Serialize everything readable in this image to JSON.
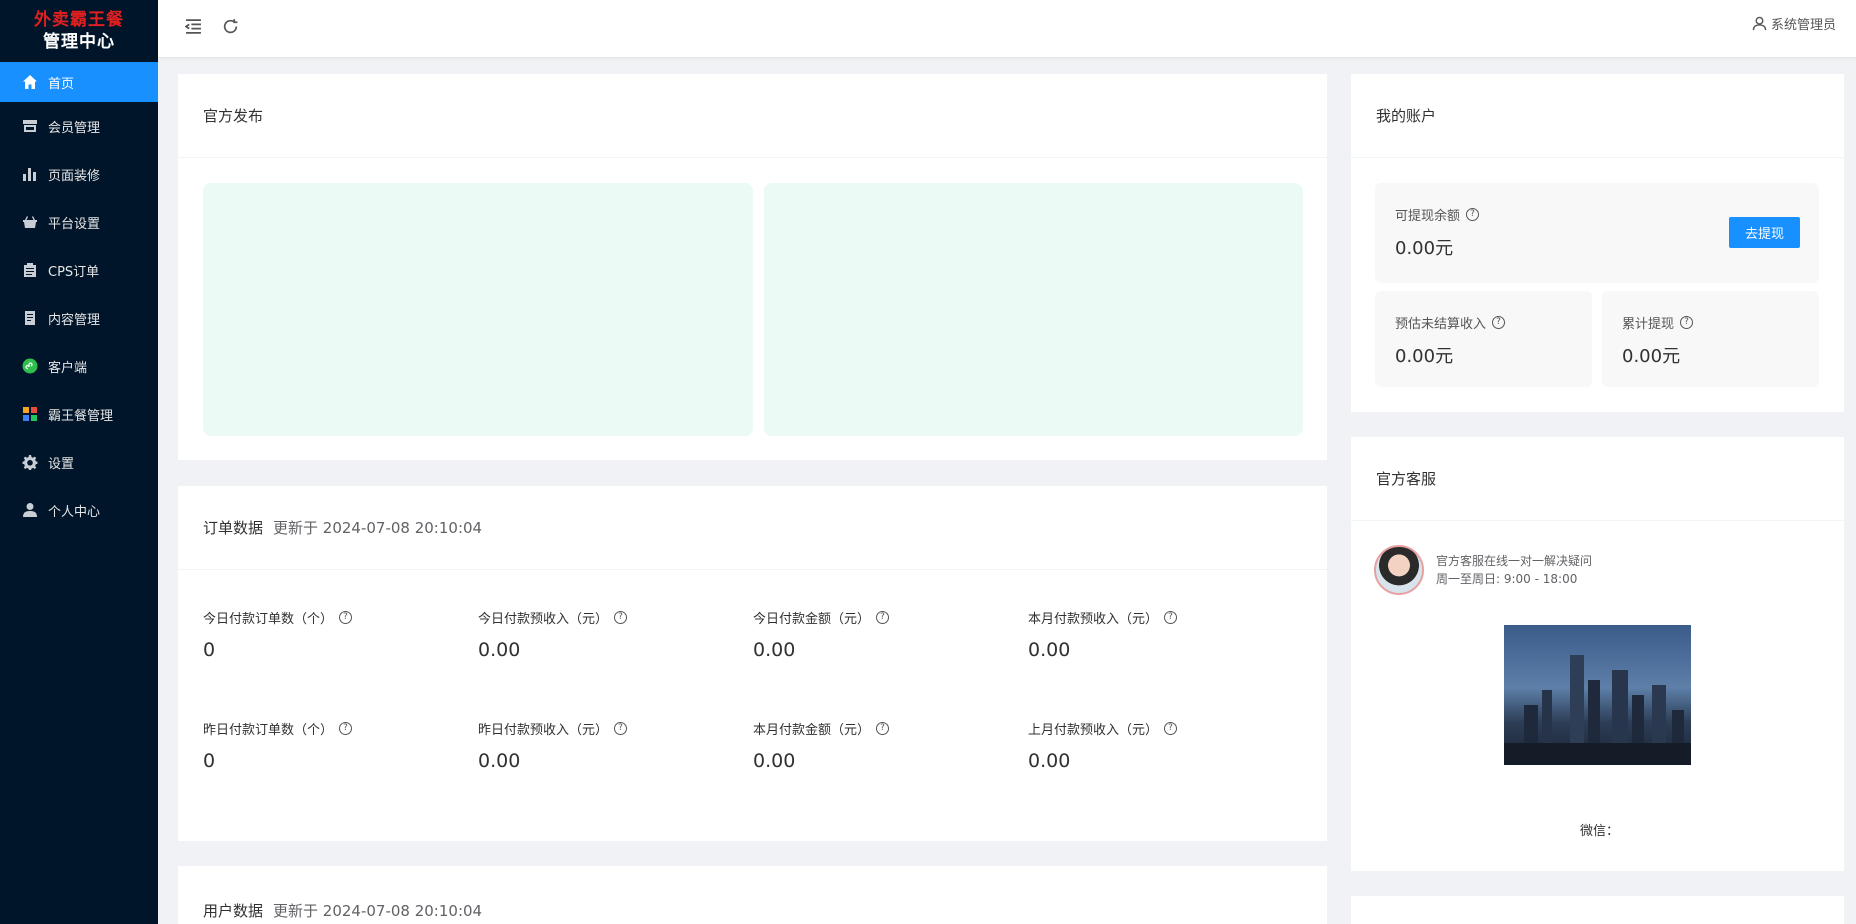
{
  "brand": {
    "line1": "外卖霸王餐",
    "line2": "管理中心"
  },
  "menu": [
    {
      "label": "首页",
      "icon": "home-icon",
      "active": true
    },
    {
      "label": "会员管理",
      "icon": "store-icon"
    },
    {
      "label": "页面装修",
      "icon": "bar-chart-icon"
    },
    {
      "label": "平台设置",
      "icon": "basket-icon"
    },
    {
      "label": "CPS订单",
      "icon": "clipboard-icon"
    },
    {
      "label": "内容管理",
      "icon": "document-icon"
    },
    {
      "label": "客户端",
      "icon": "mini-program-icon"
    },
    {
      "label": "霸王餐管理",
      "icon": "apps-icon"
    },
    {
      "label": "设置",
      "icon": "gear-icon"
    },
    {
      "label": "个人中心",
      "icon": "user-icon"
    }
  ],
  "header": {
    "user": "系统管理员"
  },
  "official": {
    "title": "官方发布"
  },
  "orders": {
    "title": "订单数据",
    "updated": "更新于 2024-07-08 20:10:04",
    "stats": [
      {
        "label": "今日付款订单数（个）",
        "value": "0"
      },
      {
        "label": "今日付款预收入（元）",
        "value": "0.00"
      },
      {
        "label": "今日付款金额（元）",
        "value": "0.00"
      },
      {
        "label": "本月付款预收入（元）",
        "value": "0.00"
      },
      {
        "label": "昨日付款订单数（个）",
        "value": "0"
      },
      {
        "label": "昨日付款预收入（元）",
        "value": "0.00"
      },
      {
        "label": "本月付款金额（元）",
        "value": "0.00"
      },
      {
        "label": "上月付款预收入（元）",
        "value": "0.00"
      }
    ]
  },
  "users": {
    "title": "用户数据",
    "updated": "更新于 2024-07-08 20:10:04"
  },
  "account": {
    "title": "我的账户",
    "withdrawable_label": "可提现余额",
    "withdrawable_value": "0.00元",
    "withdraw_button": "去提现",
    "unsettled_label": "预估未结算收入",
    "unsettled_value": "0.00元",
    "total_label": "累计提现",
    "total_value": "0.00元"
  },
  "service": {
    "title": "官方客服",
    "line1": "官方客服在线一对一解决疑问",
    "line2": "周一至周日: 9:00 - 18:00",
    "wechat": "微信："
  },
  "colors": {
    "sidebar": "#001529",
    "primary": "#1890ff",
    "brand_red": "#e02020"
  }
}
